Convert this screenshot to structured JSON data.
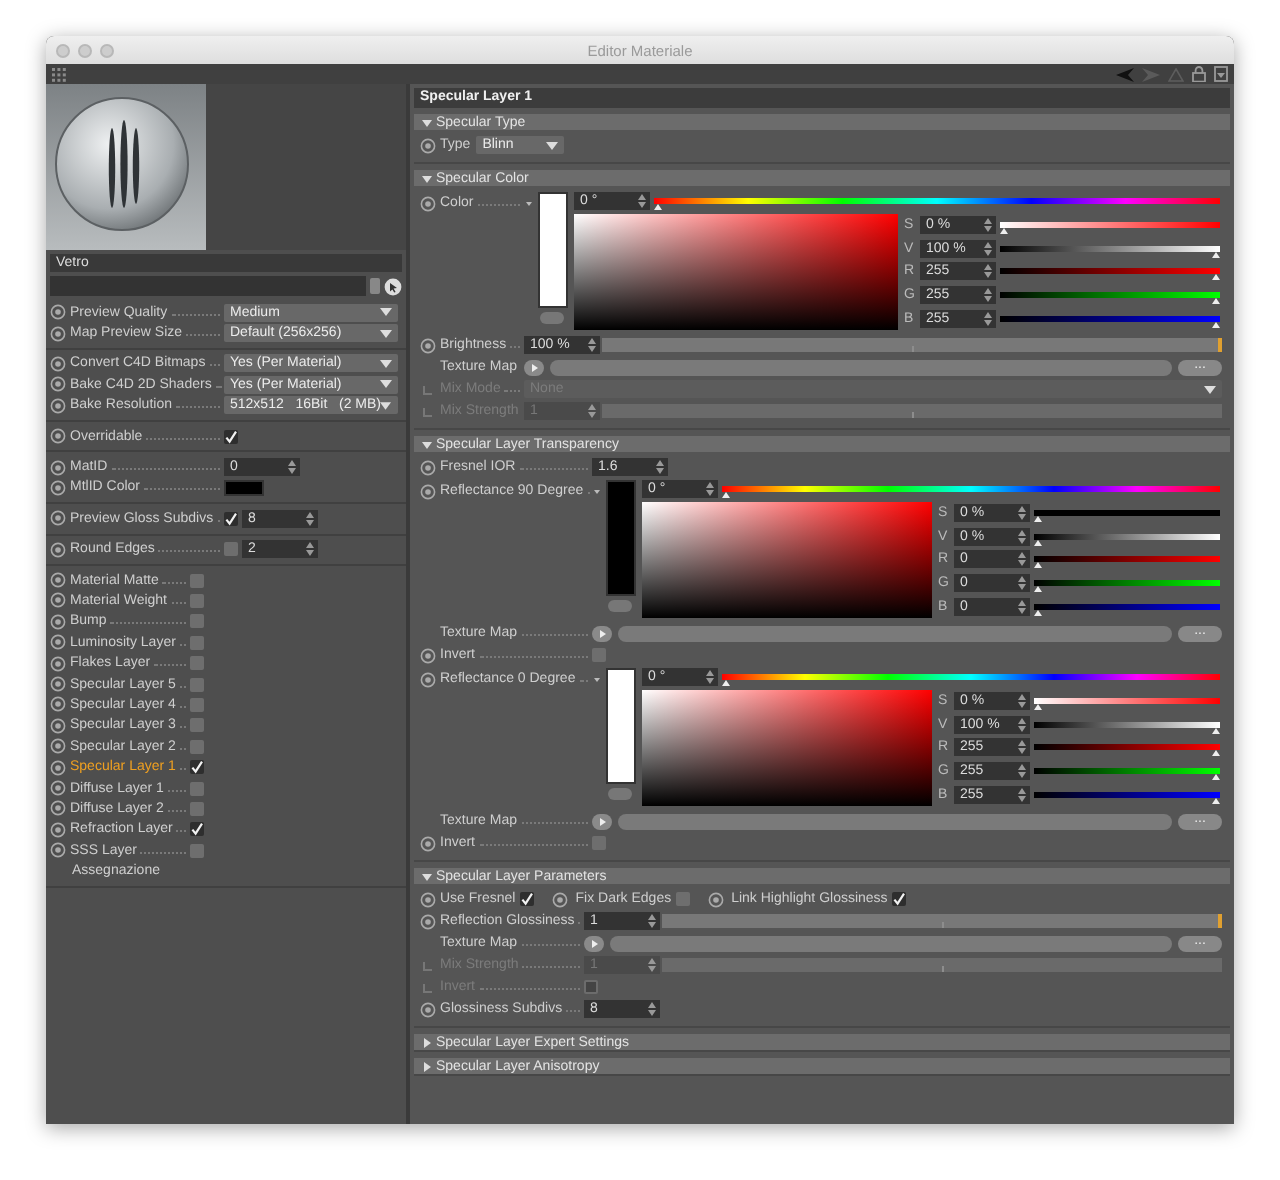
{
  "window": {
    "title": "Editor Materiale"
  },
  "material": {
    "name": "Vetro",
    "groups": [
      {
        "params": [
          {
            "kind": "select",
            "label": "Preview Quality",
            "value": "Medium"
          },
          {
            "kind": "select",
            "label": "Map Preview Size",
            "value": "Default (256x256)"
          }
        ]
      },
      {
        "params": [
          {
            "kind": "select",
            "label": "Convert C4D Bitmaps",
            "value": "Yes (Per Material)"
          },
          {
            "kind": "select",
            "label": "Bake C4D 2D Shaders",
            "value": "Yes (Per Material)"
          },
          {
            "kind": "select",
            "label": "Bake Resolution",
            "value": "512x512   16Bit   (2 MB)"
          }
        ]
      },
      {
        "params": [
          {
            "kind": "check",
            "label": "Overridable",
            "checked": true
          }
        ]
      },
      {
        "params": [
          {
            "kind": "number",
            "label": "MatID",
            "value": "0"
          },
          {
            "kind": "color",
            "label": "MtlID Color",
            "color": "#000000"
          }
        ]
      },
      {
        "params": [
          {
            "kind": "checknumber",
            "label": "Preview Gloss Subdivs",
            "checked": true,
            "value": "8"
          }
        ]
      },
      {
        "params": [
          {
            "kind": "checknumber",
            "label": "Round Edges",
            "checked": false,
            "value": "2"
          }
        ]
      }
    ],
    "layers": [
      {
        "label": "Material Matte",
        "checked": false,
        "selected": false
      },
      {
        "label": "Material Weight",
        "checked": false,
        "selected": false
      },
      {
        "label": "Bump",
        "checked": false,
        "selected": false
      },
      {
        "label": "Luminosity Layer",
        "checked": false,
        "selected": false
      },
      {
        "label": "Flakes Layer",
        "checked": false,
        "selected": false
      },
      {
        "label": "Specular Layer 5",
        "checked": false,
        "selected": false
      },
      {
        "label": "Specular Layer 4",
        "checked": false,
        "selected": false
      },
      {
        "label": "Specular Layer 3",
        "checked": false,
        "selected": false
      },
      {
        "label": "Specular Layer 2",
        "checked": false,
        "selected": false
      },
      {
        "label": "Specular Layer 1",
        "checked": true,
        "selected": true
      },
      {
        "label": "Diffuse Layer 1",
        "checked": false,
        "selected": false
      },
      {
        "label": "Diffuse Layer 2",
        "checked": false,
        "selected": false
      },
      {
        "label": "Refraction Layer",
        "checked": true,
        "selected": false
      },
      {
        "label": "SSS Layer",
        "checked": false,
        "selected": false
      }
    ],
    "assignment": "Assegnazione"
  },
  "editor": {
    "title": "Specular Layer 1",
    "sections": [
      {
        "title": "Specular Type",
        "expanded": true,
        "rows": [
          {
            "kind": "select",
            "label": "Type",
            "value": "Blinn",
            "disabled": false
          }
        ]
      },
      {
        "title": "Specular Color",
        "expanded": true,
        "rows": [
          {
            "kind": "color",
            "label": "Color",
            "disabled": false,
            "color": "#ffffff",
            "hue": {
              "value": "0 °",
              "level": 0
            },
            "channels": [
              {
                "label": "S",
                "value": "0 %",
                "level": 0
              },
              {
                "label": "V",
                "value": "100 %",
                "level": 1
              },
              {
                "label": "R",
                "value": "255",
                "level": 1
              },
              {
                "label": "G",
                "value": "255",
                "level": 1
              },
              {
                "label": "B",
                "value": "255",
                "level": 1
              }
            ]
          },
          {
            "kind": "slider",
            "label": "Brightness",
            "value": "100 %",
            "level": 1,
            "disabled": false
          },
          {
            "kind": "texture",
            "label": "Texture Map",
            "button": "...",
            "disabled": false
          },
          {
            "kind": "select",
            "label": "Mix Mode",
            "value": "None",
            "disabled": true
          },
          {
            "kind": "slider",
            "label": "Mix Strength",
            "value": "1",
            "disabled": true
          }
        ]
      },
      {
        "title": "Specular Layer Transparency",
        "expanded": true,
        "rows": [
          {
            "kind": "number",
            "label": "Fresnel IOR",
            "value": "1.6",
            "disabled": false
          },
          {
            "kind": "color",
            "label": "Reflectance 90 Degree",
            "disabled": false,
            "color": "#000000",
            "hue": {
              "value": "0 °",
              "level": 0
            },
            "channels": [
              {
                "label": "S",
                "value": "0 %",
                "level": 0
              },
              {
                "label": "V",
                "value": "0 %",
                "level": 0
              },
              {
                "label": "R",
                "value": "0",
                "level": 0
              },
              {
                "label": "G",
                "value": "0",
                "level": 0
              },
              {
                "label": "B",
                "value": "0",
                "level": 0
              }
            ]
          },
          {
            "kind": "texture",
            "label": "Texture Map",
            "button": "...",
            "disabled": false
          },
          {
            "kind": "check",
            "label": "Invert",
            "checked": false,
            "disabled": false
          },
          {
            "kind": "color",
            "label": "Reflectance  0 Degree",
            "disabled": false,
            "color": "#ffffff",
            "hue": {
              "value": "0 °",
              "level": 0
            },
            "channels": [
              {
                "label": "S",
                "value": "0 %",
                "level": 0
              },
              {
                "label": "V",
                "value": "100 %",
                "level": 1
              },
              {
                "label": "R",
                "value": "255",
                "level": 1
              },
              {
                "label": "G",
                "value": "255",
                "level": 1
              },
              {
                "label": "B",
                "value": "255",
                "level": 1
              }
            ]
          },
          {
            "kind": "texture",
            "label": "Texture Map",
            "button": "...",
            "disabled": false
          },
          {
            "kind": "check",
            "label": "Invert",
            "checked": false,
            "disabled": false
          }
        ]
      },
      {
        "title": "Specular Layer Parameters",
        "expanded": true,
        "rows": [
          {
            "kind": "checks",
            "disabled": false,
            "items": [
              {
                "label": "Use Fresnel",
                "checked": true
              },
              {
                "label": "Fix Dark Edges",
                "checked": false
              },
              {
                "label": "Link Highlight Glossiness",
                "checked": true
              }
            ]
          },
          {
            "kind": "slider",
            "label": "Reflection Glossiness",
            "value": "1",
            "level": 1,
            "disabled": false
          },
          {
            "kind": "texture",
            "label": "Texture Map",
            "button": "...",
            "disabled": false
          },
          {
            "kind": "slider",
            "label": "Mix Strength",
            "value": "1",
            "disabled": true
          },
          {
            "kind": "check",
            "label": "Invert",
            "checked": false,
            "disabled": true
          },
          {
            "kind": "number",
            "label": "Glossiness Subdivs",
            "value": "8",
            "disabled": false
          }
        ]
      },
      {
        "title": "Specular Layer Expert Settings",
        "expanded": false
      },
      {
        "title": "Specular Layer Anisotropy",
        "expanded": false
      }
    ]
  }
}
